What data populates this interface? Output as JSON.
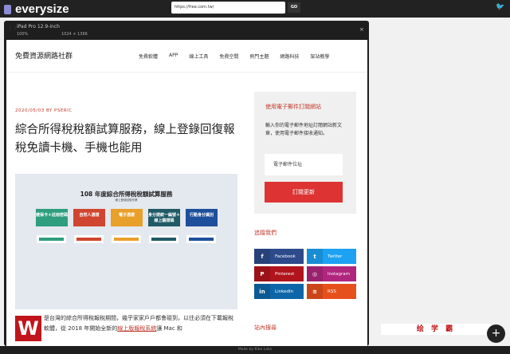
{
  "app": {
    "logo": "everysize",
    "url": "https://free.com.tw/",
    "go": "GO",
    "twitter_icon": "twitter-icon",
    "footer": "Made by Kiba Labs"
  },
  "device": {
    "name": "iPad Pro 12.9-inch",
    "zoom": "100%",
    "width": "1024",
    "x": "×",
    "height": "1366",
    "close": "×"
  },
  "site": {
    "title": "免費資源網路社群",
    "nav": [
      "免費軟體",
      "APP",
      "線上工具",
      "免費空間",
      "熱門主題",
      "網路科技",
      "架站教學"
    ]
  },
  "post": {
    "meta": "2020/05/03 BY PSERIC",
    "title": "綜合所得稅稅額試算服務，線上登錄回復報稅免讀卡機、手機也能用",
    "image": {
      "title": "108 年度綜合所得稅稅額試算服務",
      "subtitle": "線上登錄回復作業",
      "cards": [
        {
          "label": "健保卡＋註冊密碼",
          "color": "#2e9e7e"
        },
        {
          "label": "自然人憑證",
          "color": "#d0452f"
        },
        {
          "label": "電子憑證",
          "color": "#e8a02a"
        },
        {
          "label": "身分證統一編號＋線上驗證碼",
          "color": "#1f5a66"
        },
        {
          "label": "行動身分識別",
          "color": "#1d4f9c"
        }
      ]
    },
    "logo_letter": "W",
    "para_before": "是台灣的綜合所得稅報稅期間，幾乎家家戶戶都會碰到，以往必須在下載報稅軟體，從 2018 年開始全新的",
    "para_link": "線上版報稅系統",
    "para_after": "讓 Mac 和"
  },
  "sidebar": {
    "subscribe_title": "使用電子郵件訂閱網站",
    "subscribe_text": "輸入你的電子郵件地址訂閱網站新文章，使用電子郵件接收通知。",
    "email_placeholder": "電子郵件位址",
    "subscribe_button": "訂閱更新",
    "follow_title": "追蹤我們",
    "social": [
      {
        "label": "Facebook",
        "icon": "f",
        "color": "#2d4a8a"
      },
      {
        "label": "Twitter",
        "icon": "t",
        "color": "#1da1f2"
      },
      {
        "label": "Pinterest",
        "icon": "P",
        "color": "#b0141c"
      },
      {
        "label": "Instagram",
        "icon": "◎",
        "color": "#b0267e"
      },
      {
        "label": "LinkedIn",
        "icon": "in",
        "color": "#0e66a8"
      },
      {
        "label": "RSS",
        "icon": "≋",
        "color": "#e6501c"
      }
    ],
    "search_title": "站內搜尋"
  },
  "ad": {
    "text": "绘 学 霸",
    "fab": "+"
  }
}
